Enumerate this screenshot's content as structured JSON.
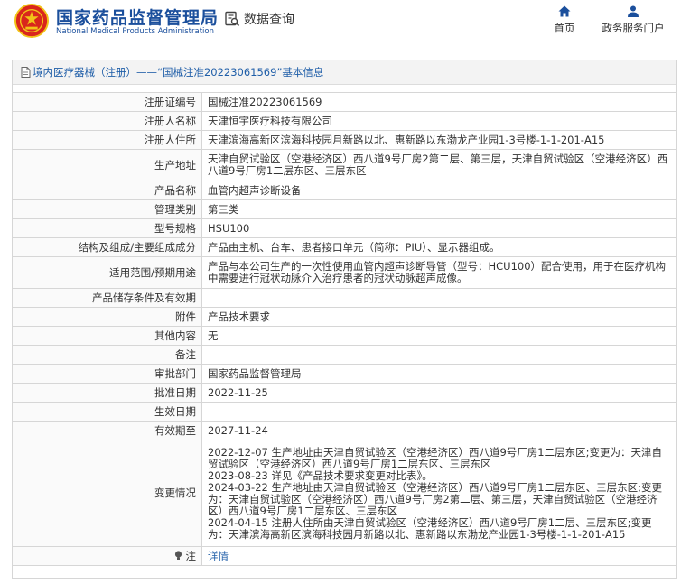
{
  "header": {
    "site_name_cn": "国家药品监督管理局",
    "site_name_en": "National Medical Products Administration",
    "data_query_label": "数据查询",
    "nav_home_label": "首页",
    "nav_portal_label": "政务服务门户"
  },
  "breadcrumb": {
    "text": "境内医疗器械（注册）——“国械注准20223061569”基本信息"
  },
  "fields": {
    "reg_no": {
      "label": "注册证编号",
      "value": "国械注准20223061569"
    },
    "registrant": {
      "label": "注册人名称",
      "value": "天津恒宇医疗科技有限公司"
    },
    "registrant_addr": {
      "label": "注册人住所",
      "value": "天津滨海高新区滨海科技园月新路以北、惠新路以东渤龙产业园1-3号楼-1-1-201-A15"
    },
    "prod_addr": {
      "label": "生产地址",
      "value": "天津自贸试验区（空港经济区）西八道9号厂房2第二层、第三层，天津自贸试验区（空港经济区）西八道9号厂房1二层东区、三层东区"
    },
    "product_name": {
      "label": "产品名称",
      "value": "血管内超声诊断设备"
    },
    "category": {
      "label": "管理类别",
      "value": "第三类"
    },
    "model": {
      "label": "型号规格",
      "value": "HSU100"
    },
    "structure": {
      "label": "结构及组成/主要组成成分",
      "value": "产品由主机、台车、患者接口单元（简称：PIU）、显示器组成。"
    },
    "scope": {
      "label": "适用范围/预期用途",
      "value": "产品与本公司生产的一次性使用血管内超声诊断导管（型号：HCU100）配合使用，用于在医疗机构中需要进行冠状动脉介入治疗患者的冠状动脉超声成像。"
    },
    "storage": {
      "label": "产品储存条件及有效期",
      "value": ""
    },
    "attachment": {
      "label": "附件",
      "value": "产品技术要求"
    },
    "other": {
      "label": "其他内容",
      "value": "无"
    },
    "remark": {
      "label": "备注",
      "value": ""
    },
    "approval_dept": {
      "label": "审批部门",
      "value": "国家药品监督管理局"
    },
    "approval_date": {
      "label": "批准日期",
      "value": "2022-11-25"
    },
    "effective_date": {
      "label": "生效日期",
      "value": ""
    },
    "expiry": {
      "label": "有效期至",
      "value": "2027-11-24"
    },
    "changes": {
      "label": "变更情况",
      "entries": [
        "2022-12-07 生产地址由天津自贸试验区（空港经济区）西八道9号厂房1二层东区;变更为：天津自贸试验区（空港经济区）西八道9号厂房1二层东区、三层东区",
        "2023-08-23 详见《产品技术要求变更对比表》。",
        "2024-03-22 生产地址由天津自贸试验区（空港经济区）西八道9号厂房1二层东区、三层东区;变更为：天津自贸试验区（空港经济区）西八道9号厂房2第二层、第三层，天津自贸试验区（空港经济区）西八道9号厂房1二层东区、三层东区",
        "2024-04-15 注册人住所由天津自贸试验区（空港经济区）西八道9号厂房1二层、三层东区;变更为：天津滨海高新区滨海科技园月新路以北、惠新路以东渤龙产业园1-3号楼-1-1-201-A15"
      ]
    },
    "note": {
      "label": "注",
      "value": "详情"
    }
  },
  "icons": {
    "emblem": "national-emblem-icon",
    "query": "document-search-icon",
    "home": "home-icon",
    "portal": "user-icon",
    "breadcrumb": "document-icon",
    "note": "lightbulb-icon"
  },
  "colors": {
    "brand_blue": "#1b4f9c",
    "link_blue": "#1f5ea8",
    "emblem_red": "#d9261c",
    "emblem_gold": "#f2c318"
  }
}
